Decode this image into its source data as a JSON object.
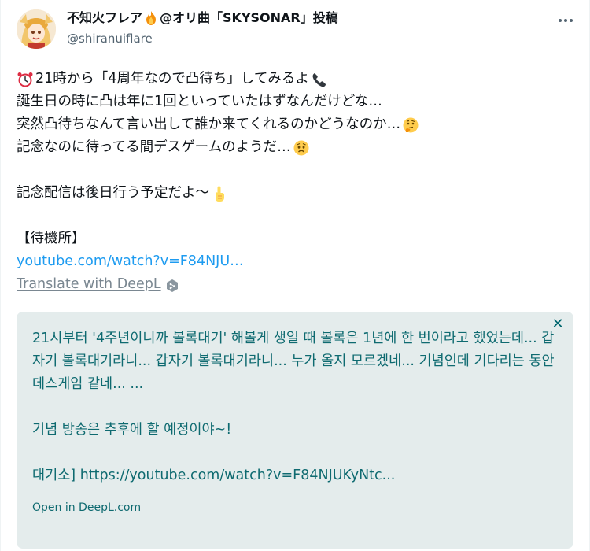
{
  "author": {
    "display_name_prefix": "不知火フレア",
    "display_name_suffix": "@オリ曲「SKYSONAR」投稿",
    "handle": "@shiranuiflare"
  },
  "tweet": {
    "line1": "21時から「4周年なので凸待ち」してみるよ",
    "line2": "誕生日の時に凸は年に1回といっていたはずなんだけどな…",
    "line3": "突然凸待ちなんて言い出して誰か来てくれるのかどうなのか…",
    "line4": "記念なのに待ってる間デスゲームのようだ…",
    "line5": "記念配信は後日行う予定だよ〜",
    "line6": "【待機所】",
    "link": "youtube.com/watch?v=F84NJU…",
    "translate": "Translate with DeepL"
  },
  "icons": {
    "more": "more-horizontal-icon",
    "fire": "fire-emoji-icon",
    "alarm": "alarm-clock-emoji-icon",
    "phone": "telephone-emoji-icon",
    "thinking": "thinking-face-emoji-icon",
    "worried": "worried-face-emoji-icon",
    "pointing": "pointing-up-emoji-icon",
    "deepl": "deepl-logo-icon",
    "close": "close-icon"
  },
  "deepl": {
    "para1": "21시부터 '4주년이니까 볼록대기' 해볼게 생일 때 볼록은 1년에 한 번이라고 했었는데... 갑자기 볼록대기라니... 갑자기 볼록대기라니... 누가 올지 모르겠네... 기념인데 기다리는 동안 데스게임 같네... ...",
    "para2": "기념 방송은 추후에 할 예정이야~!",
    "para3": "대기소] https://youtube.com/watch?v=F84NJUKyNtc...",
    "open": "Open in DeepL.com",
    "close_symbol": "✕"
  },
  "colors": {
    "link_blue": "#1d9bf0",
    "deepl_bg": "#e4ecec",
    "deepl_text": "#0e6a70",
    "handle_gray": "#536471"
  }
}
